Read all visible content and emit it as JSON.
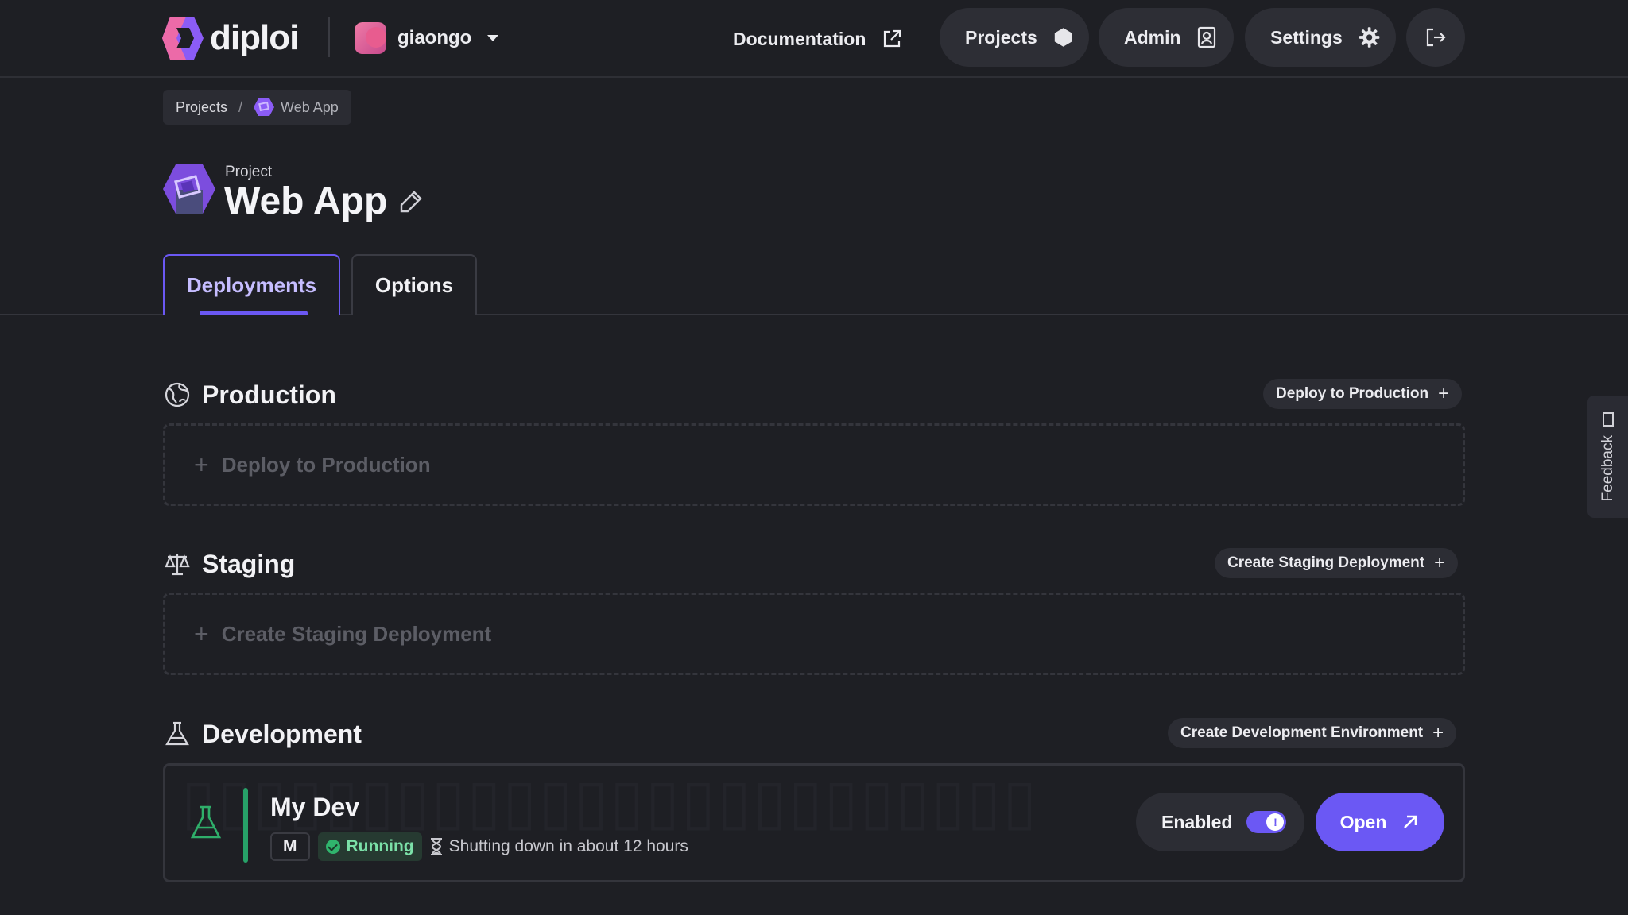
{
  "topbar": {
    "brand": "diploi",
    "team": "giaongo",
    "nav": {
      "documentation": "Documentation",
      "projects": "Projects",
      "admin": "Admin",
      "settings": "Settings"
    }
  },
  "breadcrumb": {
    "root": "Projects",
    "separator": "/",
    "current": "Web App"
  },
  "project": {
    "label": "Project",
    "name": "Web App"
  },
  "tabs": {
    "deployments": "Deployments",
    "options": "Options"
  },
  "sections": {
    "production": {
      "title": "Production",
      "action": "Deploy to Production",
      "placeholder": "Deploy to Production"
    },
    "staging": {
      "title": "Staging",
      "action": "Create Staging Deployment",
      "placeholder": "Create Staging Deployment"
    },
    "development": {
      "title": "Development",
      "action": "Create Development Environment",
      "card": {
        "name": "My Dev",
        "initial": "M",
        "status": "Running",
        "shutdown": "Shutting down in about 12 hours",
        "enabled_label": "Enabled",
        "open_label": "Open"
      }
    }
  },
  "feedback": "Feedback",
  "colors": {
    "background": "#1e1f24",
    "accent": "#6b58f4",
    "running": "#30b56d"
  }
}
